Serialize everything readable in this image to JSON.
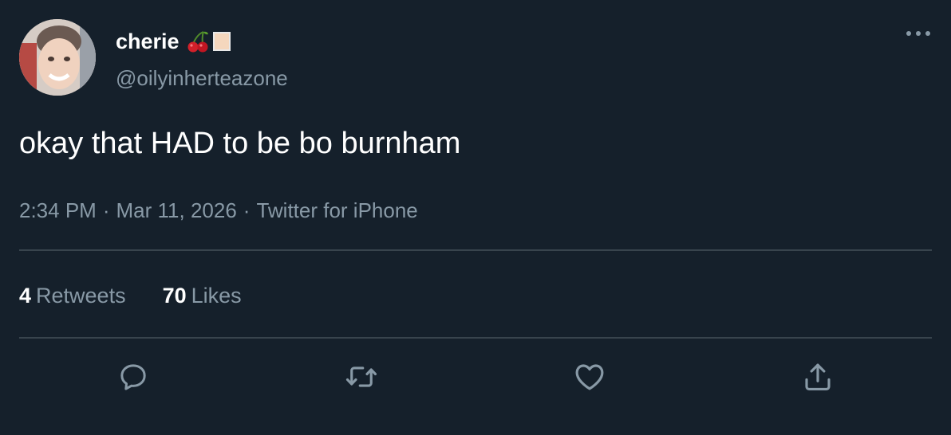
{
  "author": {
    "display_name": "cherie",
    "handle": "@oilyinherteazone",
    "name_emojis": [
      "cherries-emoji",
      "square-emoji"
    ]
  },
  "tweet": {
    "text": "okay that HAD to be bo burnham",
    "time": "2:34 PM",
    "separator": "·",
    "date": "Mar 11, 2026",
    "source": "Twitter for iPhone"
  },
  "stats": {
    "retweets_count": "4",
    "retweets_label": "Retweets",
    "likes_count": "70",
    "likes_label": "Likes"
  },
  "actions": [
    "reply-icon",
    "retweet-icon",
    "like-icon",
    "share-icon"
  ],
  "colors": {
    "background": "#15202b",
    "primary_text": "#ffffff",
    "secondary_text": "#8899a6",
    "divider": "#38444d"
  }
}
